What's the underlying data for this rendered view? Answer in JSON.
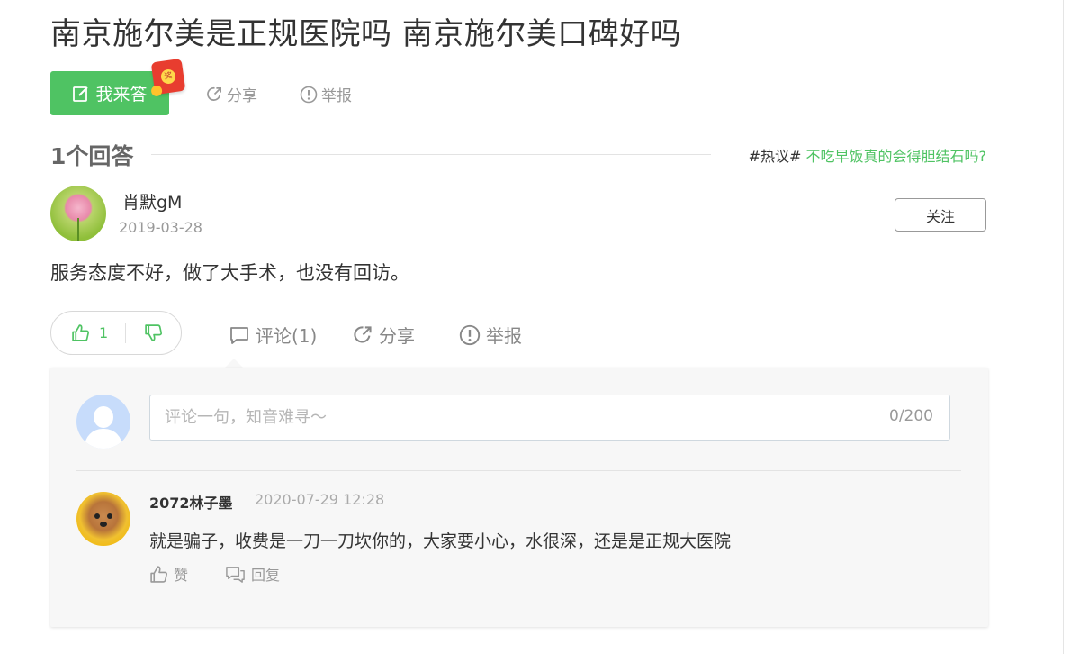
{
  "question": {
    "title": "南京施尔美是正规医院吗 南京施尔美口碑好吗",
    "answer_button": "我来答",
    "share_label": "分享",
    "report_label": "举报"
  },
  "answers_header": {
    "count_label": "1个回答",
    "hot_tag": "#热议#",
    "hot_link": "不吃早饭真的会得胆结石吗?"
  },
  "answer": {
    "author": "肖默gM",
    "date": "2019-03-28",
    "follow_label": "关注",
    "content": "服务态度不好，做了大手术，也没有回访。",
    "likes": "1",
    "comment_label": "评论(1)",
    "share_label": "分享",
    "report_label": "举报"
  },
  "comment_box": {
    "placeholder": "评论一句，知音难寻～",
    "counter": "0/200"
  },
  "comments": [
    {
      "author": "2072林子墨",
      "time": "2020-07-29 12:28",
      "text": "就是骗子，收费是一刀一刀坎你的，大家要小心，水很深，还是是正规大医院",
      "like_label": "赞",
      "reply_label": "回复"
    }
  ],
  "colors": {
    "accent_green": "#4fc363",
    "red_packet": "#e83d2f"
  }
}
